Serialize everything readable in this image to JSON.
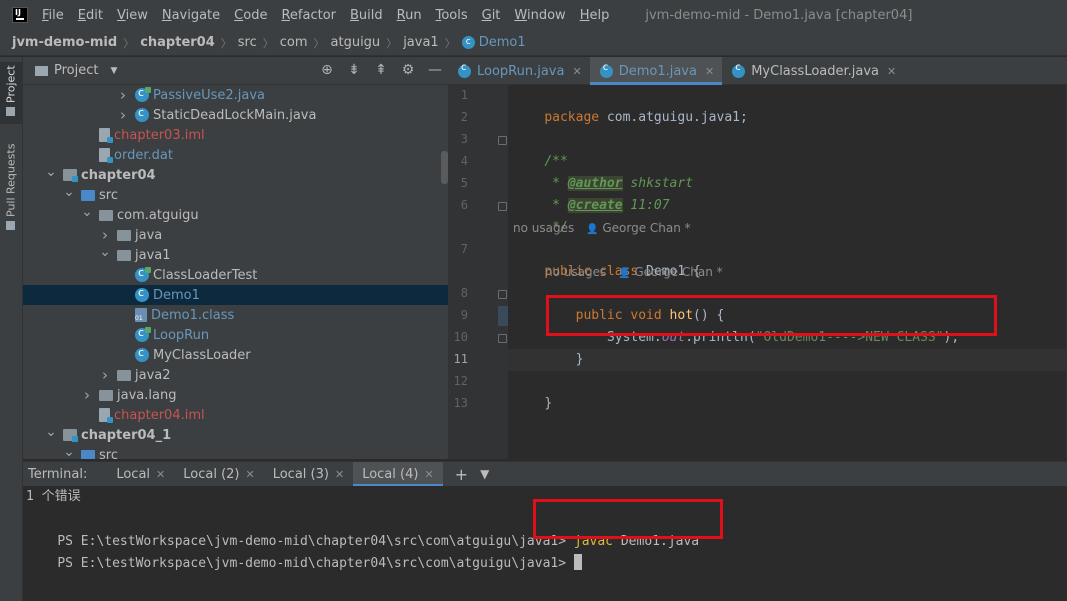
{
  "menubar": {
    "items": [
      "File",
      "Edit",
      "View",
      "Navigate",
      "Code",
      "Refactor",
      "Build",
      "Run",
      "Tools",
      "Git",
      "Window",
      "Help"
    ],
    "window_title": "jvm-demo-mid - Demo1.java [chapter04]"
  },
  "breadcrumb": {
    "items": [
      "jvm-demo-mid",
      "chapter04",
      "src",
      "com",
      "atguigu",
      "java1",
      "Demo1"
    ]
  },
  "left_strip": {
    "project_tab": "Project",
    "pull_requests_tab": "Pull Requests"
  },
  "project_panel": {
    "title": "Project",
    "tree": [
      {
        "label": "PassiveUse2.java",
        "indent": 5,
        "arrow": "right",
        "icon": "class-run",
        "style": "blue"
      },
      {
        "label": "StaticDeadLockMain.java",
        "indent": 5,
        "arrow": "right",
        "icon": "class",
        "style": "plain"
      },
      {
        "label": "chapter03.iml",
        "indent": 3,
        "arrow": "none",
        "icon": "file",
        "style": "red"
      },
      {
        "label": "order.dat",
        "indent": 3,
        "arrow": "none",
        "icon": "file",
        "style": "blue"
      },
      {
        "label": "chapter04",
        "indent": 1,
        "arrow": "down",
        "icon": "module",
        "style": "bold"
      },
      {
        "label": "src",
        "indent": 2,
        "arrow": "down",
        "icon": "src",
        "style": "plain"
      },
      {
        "label": "com.atguigu",
        "indent": 3,
        "arrow": "down",
        "icon": "pkg",
        "style": "plain"
      },
      {
        "label": "java",
        "indent": 4,
        "arrow": "right",
        "icon": "pkg",
        "style": "plain"
      },
      {
        "label": "java1",
        "indent": 4,
        "arrow": "down",
        "icon": "pkg",
        "style": "plain"
      },
      {
        "label": "ClassLoaderTest",
        "indent": 5,
        "arrow": "none",
        "icon": "class-run",
        "style": "plain"
      },
      {
        "label": "Demo1",
        "indent": 5,
        "arrow": "none",
        "icon": "class",
        "style": "blue",
        "selected": true
      },
      {
        "label": "Demo1.class",
        "indent": 5,
        "arrow": "none",
        "icon": "classfile",
        "style": "blue"
      },
      {
        "label": "LoopRun",
        "indent": 5,
        "arrow": "none",
        "icon": "class-run",
        "style": "blue"
      },
      {
        "label": "MyClassLoader",
        "indent": 5,
        "arrow": "none",
        "icon": "class",
        "style": "plain"
      },
      {
        "label": "java2",
        "indent": 4,
        "arrow": "right",
        "icon": "pkg",
        "style": "plain"
      },
      {
        "label": "java.lang",
        "indent": 3,
        "arrow": "right",
        "icon": "pkg",
        "style": "plain"
      },
      {
        "label": "chapter04.iml",
        "indent": 3,
        "arrow": "none",
        "icon": "file",
        "style": "red"
      },
      {
        "label": "chapter04_1",
        "indent": 1,
        "arrow": "down",
        "icon": "module",
        "style": "bold"
      },
      {
        "label": "src",
        "indent": 2,
        "arrow": "down",
        "icon": "src",
        "style": "plain"
      }
    ]
  },
  "editor": {
    "tabs": [
      {
        "label": "LoopRun.java",
        "active": false
      },
      {
        "label": "Demo1.java",
        "active": true
      },
      {
        "label": "MyClassLoader.java",
        "active": false
      }
    ],
    "line_numbers": [
      "1",
      "2",
      "3",
      "4",
      "5",
      "6",
      "7",
      "8",
      "9",
      "10",
      "11",
      "12",
      "13"
    ],
    "code": {
      "l1_kw": "package",
      "l1_rest": " com.atguigu.java1;",
      "l3": "/**",
      "l4_star": " * ",
      "l4_tag": "@author",
      "l4_val": " shkstart",
      "l5_star": " * ",
      "l5_tag": "@create",
      "l5_val": " 11:07",
      "l6": " */",
      "hint1_usages": "no usages",
      "hint1_author": "George Chan *",
      "l7_kw": "public class",
      "l7_rest": " Demo1 {",
      "hint2_usages": "no usages",
      "hint2_author": "George Chan *",
      "l8_kw": "    public void",
      "l8_method": " hot",
      "l8_rest": "() {",
      "l9_pre": "        System.",
      "l9_field": "out",
      "l9_mid": ".println(",
      "l9_str": "\"OldDemo1---->NEW CLASS\"",
      "l9_end": ");",
      "l10": "    }",
      "l12": "}"
    }
  },
  "terminal": {
    "label": "Terminal:",
    "tabs": [
      {
        "label": "Local",
        "active": false
      },
      {
        "label": "Local (2)",
        "active": false
      },
      {
        "label": "Local (3)",
        "active": false
      },
      {
        "label": "Local (4)",
        "active": true
      }
    ],
    "line1": "1 个错误",
    "line2_prompt": "PS E:\\testWorkspace\\jvm-demo-mid\\chapter04\\src\\com\\atguigu\\java1> ",
    "line2_cmd": "javac",
    "line2_arg": " Demo1.java",
    "line3_prompt": "PS E:\\testWorkspace\\jvm-demo-mid\\chapter04\\src\\com\\atguigu\\java1> "
  },
  "colors": {
    "annotation_red": "#e0101a",
    "accent_blue": "#4a88c7"
  }
}
